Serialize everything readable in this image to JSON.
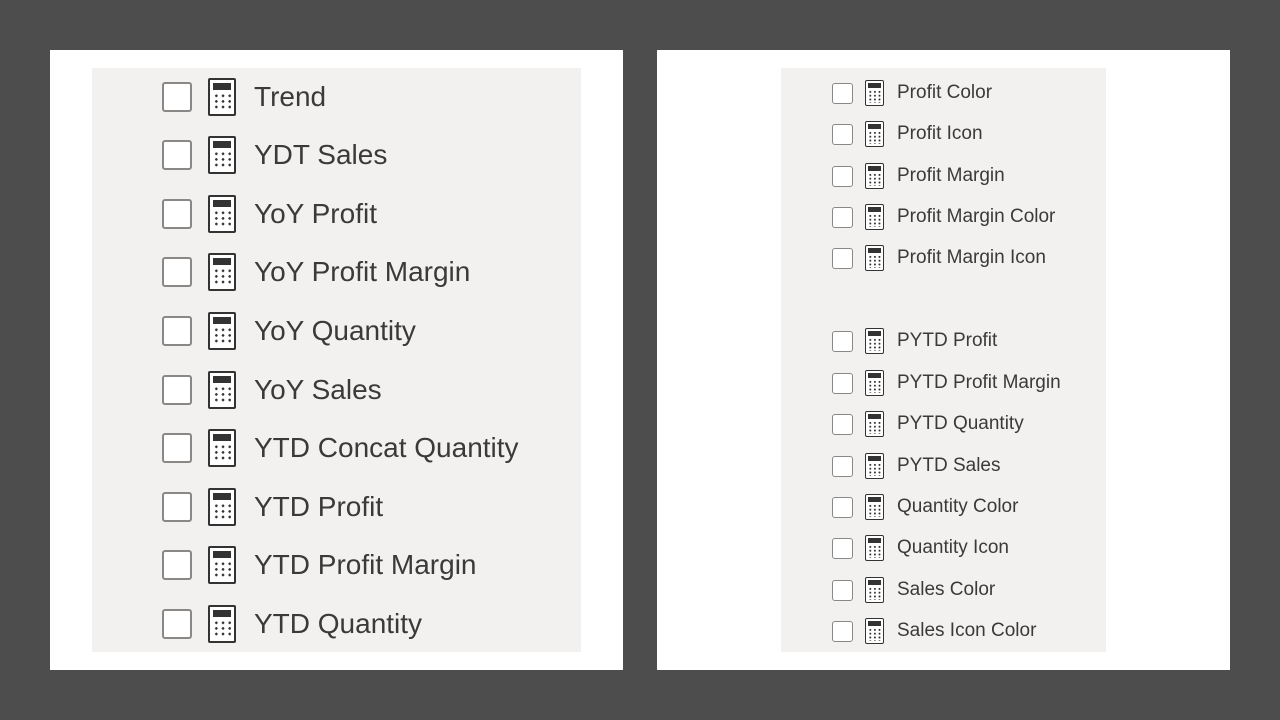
{
  "left_panel": {
    "fields": [
      {
        "label": "Trend",
        "checked": false,
        "icon": "calculator-icon"
      },
      {
        "label": "YDT Sales",
        "checked": false,
        "icon": "calculator-icon"
      },
      {
        "label": "YoY Profit",
        "checked": false,
        "icon": "calculator-icon"
      },
      {
        "label": "YoY Profit Margin",
        "checked": false,
        "icon": "calculator-icon"
      },
      {
        "label": "YoY Quantity",
        "checked": false,
        "icon": "calculator-icon"
      },
      {
        "label": "YoY Sales",
        "checked": false,
        "icon": "calculator-icon"
      },
      {
        "label": "YTD Concat Quantity",
        "checked": false,
        "icon": "calculator-icon"
      },
      {
        "label": "YTD Profit",
        "checked": false,
        "icon": "calculator-icon"
      },
      {
        "label": "YTD Profit Margin",
        "checked": false,
        "icon": "calculator-icon"
      },
      {
        "label": "YTD Quantity",
        "checked": false,
        "icon": "calculator-icon"
      }
    ]
  },
  "right_panel": {
    "fields": [
      {
        "label": "Profit Color",
        "checked": false,
        "icon": "calculator-icon"
      },
      {
        "label": "Profit Icon",
        "checked": false,
        "icon": "calculator-icon"
      },
      {
        "label": "Profit Margin",
        "checked": false,
        "icon": "calculator-icon"
      },
      {
        "label": "Profit Margin Color",
        "checked": false,
        "icon": "calculator-icon"
      },
      {
        "label": "Profit Margin Icon",
        "checked": false,
        "icon": "calculator-icon"
      },
      {
        "label": "PYTD Profit",
        "checked": false,
        "icon": "calculator-icon"
      },
      {
        "label": "PYTD Profit Margin",
        "checked": false,
        "icon": "calculator-icon"
      },
      {
        "label": "PYTD Quantity",
        "checked": false,
        "icon": "calculator-icon"
      },
      {
        "label": "PYTD Sales",
        "checked": false,
        "icon": "calculator-icon"
      },
      {
        "label": "Quantity Color",
        "checked": false,
        "icon": "calculator-icon"
      },
      {
        "label": "Quantity Icon",
        "checked": false,
        "icon": "calculator-icon"
      },
      {
        "label": "Sales Color",
        "checked": false,
        "icon": "calculator-icon"
      },
      {
        "label": "Sales Icon Color",
        "checked": false,
        "icon": "calculator-icon"
      }
    ]
  },
  "colors": {
    "background": "#4d4d4d",
    "card": "#ffffff",
    "pane": "#f2f1ef",
    "text": "#3b3a39",
    "checkbox_border": "#8a8886",
    "icon": "#333333"
  }
}
